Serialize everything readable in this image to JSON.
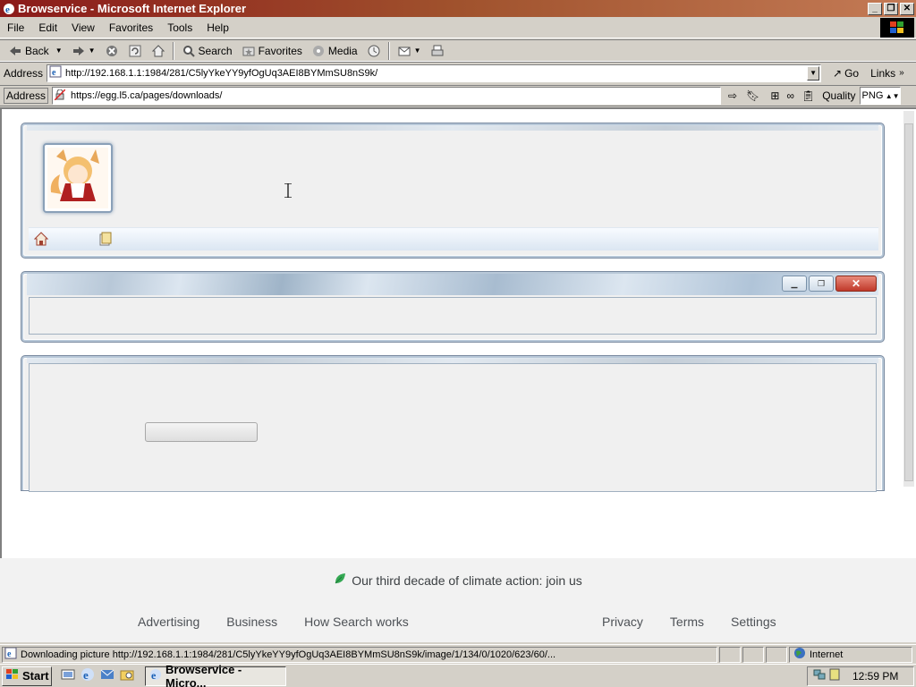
{
  "window": {
    "title": "Browservice - Microsoft Internet Explorer"
  },
  "menu": [
    "File",
    "Edit",
    "View",
    "Favorites",
    "Tools",
    "Help"
  ],
  "toolbar": {
    "back": "Back",
    "search": "Search",
    "favorites": "Favorites",
    "media": "Media"
  },
  "address": {
    "label": "Address",
    "url": "http://192.168.1.1:1984/281/C5lyYkeYY9yfOgUq3AEI8BYMmSU8nS9k/",
    "go": "Go",
    "links": "Links"
  },
  "inner": {
    "label": "Address",
    "url": "https://egg.l5.ca/pages/downloads/",
    "quality_label": "Quality",
    "quality_value": "PNG"
  },
  "footer": {
    "climate": "Our third decade of climate action: join us",
    "links_left": [
      "Advertising",
      "Business",
      "How Search works"
    ],
    "links_right": [
      "Privacy",
      "Terms",
      "Settings"
    ]
  },
  "status": {
    "text": "Downloading picture http://192.168.1.1:1984/281/C5lyYkeYY9yfOgUq3AEI8BYMmSU8nS9k/image/1/134/0/1020/623/60/...",
    "zone": "Internet"
  },
  "taskbar": {
    "start": "Start",
    "task": "Browservice - Micro...",
    "clock": "12:59 PM"
  }
}
